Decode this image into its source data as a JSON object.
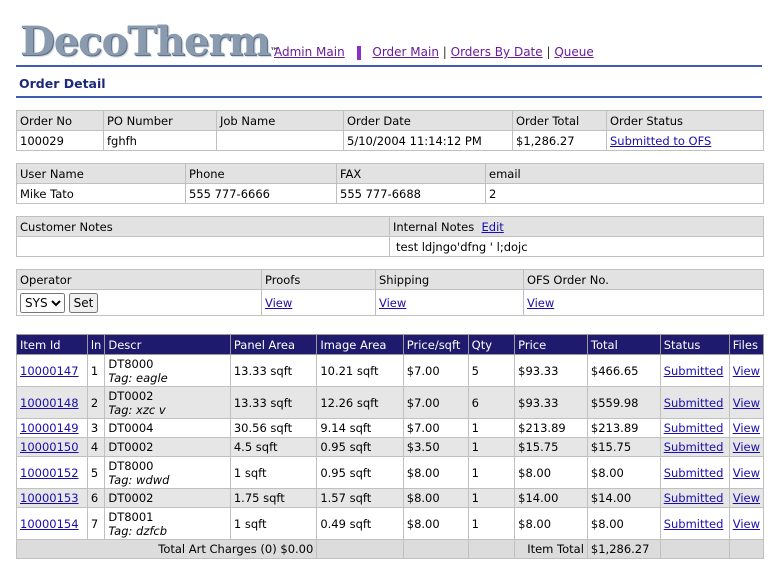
{
  "header": {
    "logo_text": "DecoTherm",
    "logo_tm": "™",
    "nav": {
      "admin_main": "Admin Main",
      "order_main": "Order Main",
      "orders_by_date": "Orders By Date",
      "queue": "Queue",
      "sep": "|"
    }
  },
  "page_title": "Order Detail",
  "order": {
    "headers": [
      "Order No",
      "PO Number",
      "Job Name",
      "Order Date",
      "Order Total",
      "Order Status"
    ],
    "order_no": "100029",
    "po_number": "fghfh",
    "job_name": "",
    "order_date": "5/10/2004 11:14:12 PM",
    "order_total": "$1,286.27",
    "order_status": "Submitted to OFS"
  },
  "user": {
    "headers": [
      "User Name",
      "Phone",
      "FAX",
      "email"
    ],
    "user_name": "Mike Tato",
    "phone": "555 777-6666",
    "fax": "555 777-6688",
    "email": "2"
  },
  "notes": {
    "customer_label": "Customer Notes",
    "customer_value": "",
    "internal_label": "Internal Notes",
    "edit_link": "Edit",
    "internal_value": "test ldjngo'dfng ' l;dojc"
  },
  "ops": {
    "headers": [
      "Operator",
      "Proofs",
      "Shipping",
      "OFS Order No."
    ],
    "operator_selected": "SYS",
    "set_button": "Set",
    "proofs_link": "View",
    "shipping_link": "View",
    "ofs_link": "View"
  },
  "items": {
    "headers": [
      "Item Id",
      "ln",
      "Descr",
      "Panel Area",
      "Image Area",
      "Price/sqft",
      "Qty",
      "Price",
      "Total",
      "Status",
      "Files"
    ],
    "rows": [
      {
        "id": "10000147",
        "ln": "1",
        "descr": "DT8000",
        "tag": "Tag: eagle",
        "panel": "13.33 sqft",
        "image": "10.21 sqft",
        "ppsf": "$7.00",
        "qty": "5",
        "price": "$93.33",
        "total": "$466.65",
        "status": "Submitted",
        "files": "View"
      },
      {
        "id": "10000148",
        "ln": "2",
        "descr": "DT0002",
        "tag": "Tag: xzc v",
        "panel": "13.33 sqft",
        "image": "12.26 sqft",
        "ppsf": "$7.00",
        "qty": "6",
        "price": "$93.33",
        "total": "$559.98",
        "status": "Submitted",
        "files": "View"
      },
      {
        "id": "10000149",
        "ln": "3",
        "descr": "DT0004",
        "tag": "",
        "panel": "30.56 sqft",
        "image": "9.14 sqft",
        "ppsf": "$7.00",
        "qty": "1",
        "price": "$213.89",
        "total": "$213.89",
        "status": "Submitted",
        "files": "View"
      },
      {
        "id": "10000150",
        "ln": "4",
        "descr": "DT0002",
        "tag": "",
        "panel": "4.5 sqft",
        "image": "0.95 sqft",
        "ppsf": "$3.50",
        "qty": "1",
        "price": "$15.75",
        "total": "$15.75",
        "status": "Submitted",
        "files": "View"
      },
      {
        "id": "10000152",
        "ln": "5",
        "descr": "DT8000",
        "tag": "Tag: wdwd",
        "panel": "1 sqft",
        "image": "0.95 sqft",
        "ppsf": "$8.00",
        "qty": "1",
        "price": "$8.00",
        "total": "$8.00",
        "status": "Submitted",
        "files": "View"
      },
      {
        "id": "10000153",
        "ln": "6",
        "descr": "DT0002",
        "tag": "",
        "panel": "1.75 sqft",
        "image": "1.57 sqft",
        "ppsf": "$8.00",
        "qty": "1",
        "price": "$14.00",
        "total": "$14.00",
        "status": "Submitted",
        "files": "View"
      },
      {
        "id": "10000154",
        "ln": "7",
        "descr": "DT8001",
        "tag": "Tag: dzfcb",
        "panel": "1 sqft",
        "image": "0.49 sqft",
        "ppsf": "$8.00",
        "qty": "1",
        "price": "$8.00",
        "total": "$8.00",
        "status": "Submitted",
        "files": "View"
      }
    ],
    "footer": {
      "art_charges": "Total Art Charges (0) $0.00",
      "item_total_label": "Item Total",
      "item_total_value": "$1,286.27"
    }
  },
  "colors": {
    "accent": "#3f5bb5",
    "header_bg": "#1e1a6e",
    "link": "#1a0dab",
    "nav_link": "#6a1b9a"
  }
}
